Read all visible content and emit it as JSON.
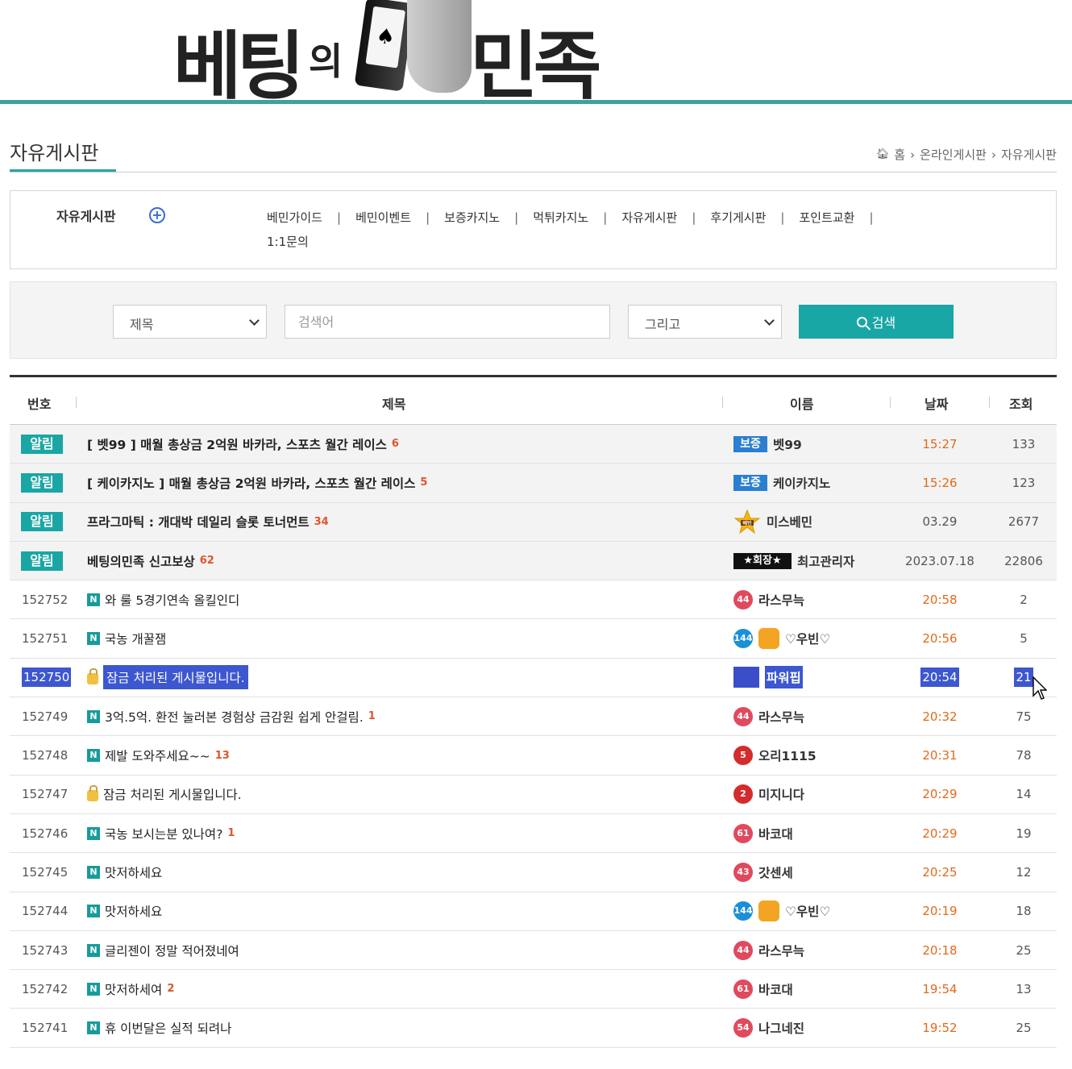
{
  "logo": {
    "part1": "베팅",
    "part2": "의",
    "part3": "민족",
    "card_glyph": "♠"
  },
  "page_title": "자유게시판",
  "breadcrumb": {
    "home": "홈",
    "level1": "온라인게시판",
    "level2": "자유게시판"
  },
  "category": {
    "board_name": "자유게시판",
    "links": [
      "베민가이드",
      "베민이벤트",
      "보증카지노",
      "먹튀카지노",
      "자유게시판",
      "후기게시판",
      "포인트교환",
      "1:1문의"
    ]
  },
  "search": {
    "field_select": "제목",
    "placeholder": "검색어",
    "operator_select": "그리고",
    "button_label": "검색"
  },
  "table": {
    "headers": {
      "num": "번호",
      "subject": "제목",
      "name": "이름",
      "date": "날짜",
      "views": "조회"
    },
    "notice_label": "알림",
    "new_icon": "N",
    "rows": [
      {
        "notice": true,
        "subject": "[ 벳99 ] 매월 총상금 2억원 바카라, 스포츠 월간 레이스",
        "comments": "6",
        "author_tag": "보증",
        "author": "벳99",
        "date": "15:27",
        "views": "133"
      },
      {
        "notice": true,
        "subject": "[ 케이카지노 ] 매월 총상금 2억원 바카라, 스포츠 월간 레이스",
        "comments": "5",
        "author_tag": "보증",
        "author": "케이카지노",
        "date": "15:26",
        "views": "123"
      },
      {
        "notice": true,
        "subject": "프라그마틱 : 개대박 데일리 슬롯 토너먼트",
        "comments": "34",
        "author_tag": "베민",
        "author": "미스베민",
        "date": "03.29",
        "views": "2677"
      },
      {
        "notice": true,
        "subject": "베팅의민족 신고보상",
        "comments": "62",
        "author_tag": "★회장★",
        "author": "최고관리자",
        "date": "2023.07.18",
        "views": "22806"
      },
      {
        "num": "152752",
        "subject": "와 룰 5경기연속 올킬인디",
        "comments": "",
        "level": "44",
        "author": "라스무늑",
        "date": "20:58",
        "views": "2"
      },
      {
        "num": "152751",
        "subject": "국농 개꿀잼",
        "comments": "",
        "level": "144",
        "author": "♡우빈♡",
        "date": "20:56",
        "views": "5"
      },
      {
        "num": "152750",
        "subject": "잠금 처리된 게시물입니다.",
        "comments": "",
        "author": "파워핍",
        "date": "20:54",
        "views": "21",
        "locked": true,
        "selected": true
      },
      {
        "num": "152749",
        "subject": "3억.5억. 환전 눌러본 경험상 금감원 쉽게 안걸림.",
        "comments": "1",
        "level": "44",
        "author": "라스무늑",
        "date": "20:32",
        "views": "75"
      },
      {
        "num": "152748",
        "subject": "제발 도와주세요~~",
        "comments": "13",
        "level": "5",
        "author": "오리1115",
        "date": "20:31",
        "views": "78"
      },
      {
        "num": "152747",
        "subject": "잠금 처리된 게시물입니다.",
        "comments": "",
        "level": "2",
        "author": "미지니다",
        "date": "20:29",
        "views": "14",
        "locked": true
      },
      {
        "num": "152746",
        "subject": "국농 보시는분 있나여?",
        "comments": "1",
        "level": "61",
        "author": "바코대",
        "date": "20:29",
        "views": "19"
      },
      {
        "num": "152745",
        "subject": "맛저하세요",
        "comments": "",
        "level": "43",
        "author": "갓센세",
        "date": "20:25",
        "views": "12"
      },
      {
        "num": "152744",
        "subject": "맛저하세요",
        "comments": "",
        "level": "144",
        "author": "♡우빈♡",
        "date": "20:19",
        "views": "18"
      },
      {
        "num": "152743",
        "subject": "글리젠이 정말 적어졌네여",
        "comments": "",
        "level": "44",
        "author": "라스무늑",
        "date": "20:18",
        "views": "25"
      },
      {
        "num": "152742",
        "subject": "맛저하세여",
        "comments": "2",
        "level": "61",
        "author": "바코대",
        "date": "19:54",
        "views": "13"
      },
      {
        "num": "152741",
        "subject": "휴 이번달은 실적 되려나",
        "comments": "",
        "level": "54",
        "author": "나그네진",
        "date": "19:52",
        "views": "25"
      }
    ]
  },
  "colors": {
    "accent": "#18a7a5",
    "comment": "#e0552c",
    "time": "#e06a1a",
    "selection": "#3c57d0"
  }
}
